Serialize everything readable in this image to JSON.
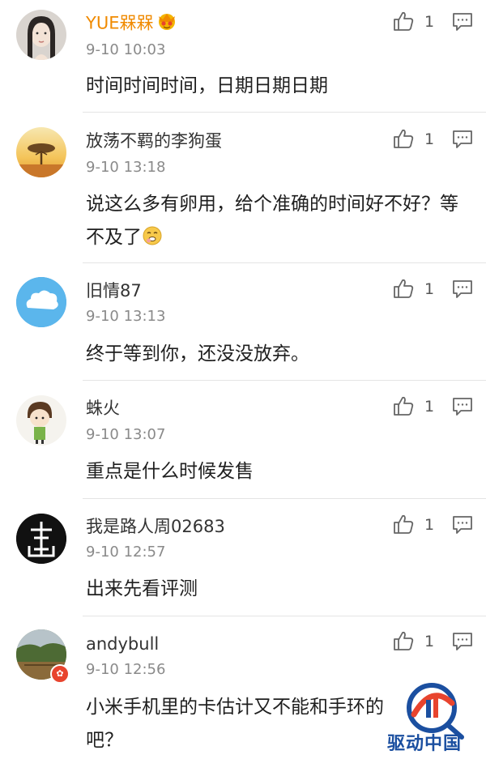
{
  "comments": [
    {
      "username": "YUE槑槑",
      "time": "9-10 10:03",
      "text": "时间时间时间，日期日期日期",
      "likes": "1",
      "avatar": "avatar-girl-portrait",
      "vip_icon": "crown-emoji-icon"
    },
    {
      "username": "放荡不羁的李狗蛋",
      "time": "9-10 13:18",
      "text": "说这么多有卵用，给个准确的时间好不好？等不及了",
      "likes": "1",
      "avatar": "avatar-sunset-tree",
      "emoji": "pleading-face-emoji"
    },
    {
      "username": "旧情87",
      "time": "9-10 13:13",
      "text": "终于等到你，还没没放弃。",
      "likes": "1",
      "avatar": "avatar-blue-cloud"
    },
    {
      "username": "蛛火",
      "time": "9-10 13:07",
      "text": "重点是什么时候发售",
      "likes": "1",
      "avatar": "avatar-cartoon-boy"
    },
    {
      "username": "我是路人周02683",
      "time": "9-10 12:57",
      "text": "出来先看评测",
      "likes": "1",
      "avatar": "avatar-black-seal"
    },
    {
      "username": "andybull",
      "time": "9-10 12:56",
      "text": "小米手机里的卡估计又不能和手环的",
      "text_tail": "吧？",
      "likes": "1",
      "avatar": "avatar-landscape",
      "badge": "✿"
    }
  ],
  "watermark": {
    "text": "驱动中国",
    "logo": "drivers-china-logo"
  },
  "icons": {
    "like": "thumbs-up-icon",
    "reply": "comment-bubble-icon"
  },
  "colors": {
    "vip_name": "#f08a00",
    "time": "#8a8a8a",
    "divider": "#e4e4e4",
    "watermark": "#1b4fa0"
  }
}
